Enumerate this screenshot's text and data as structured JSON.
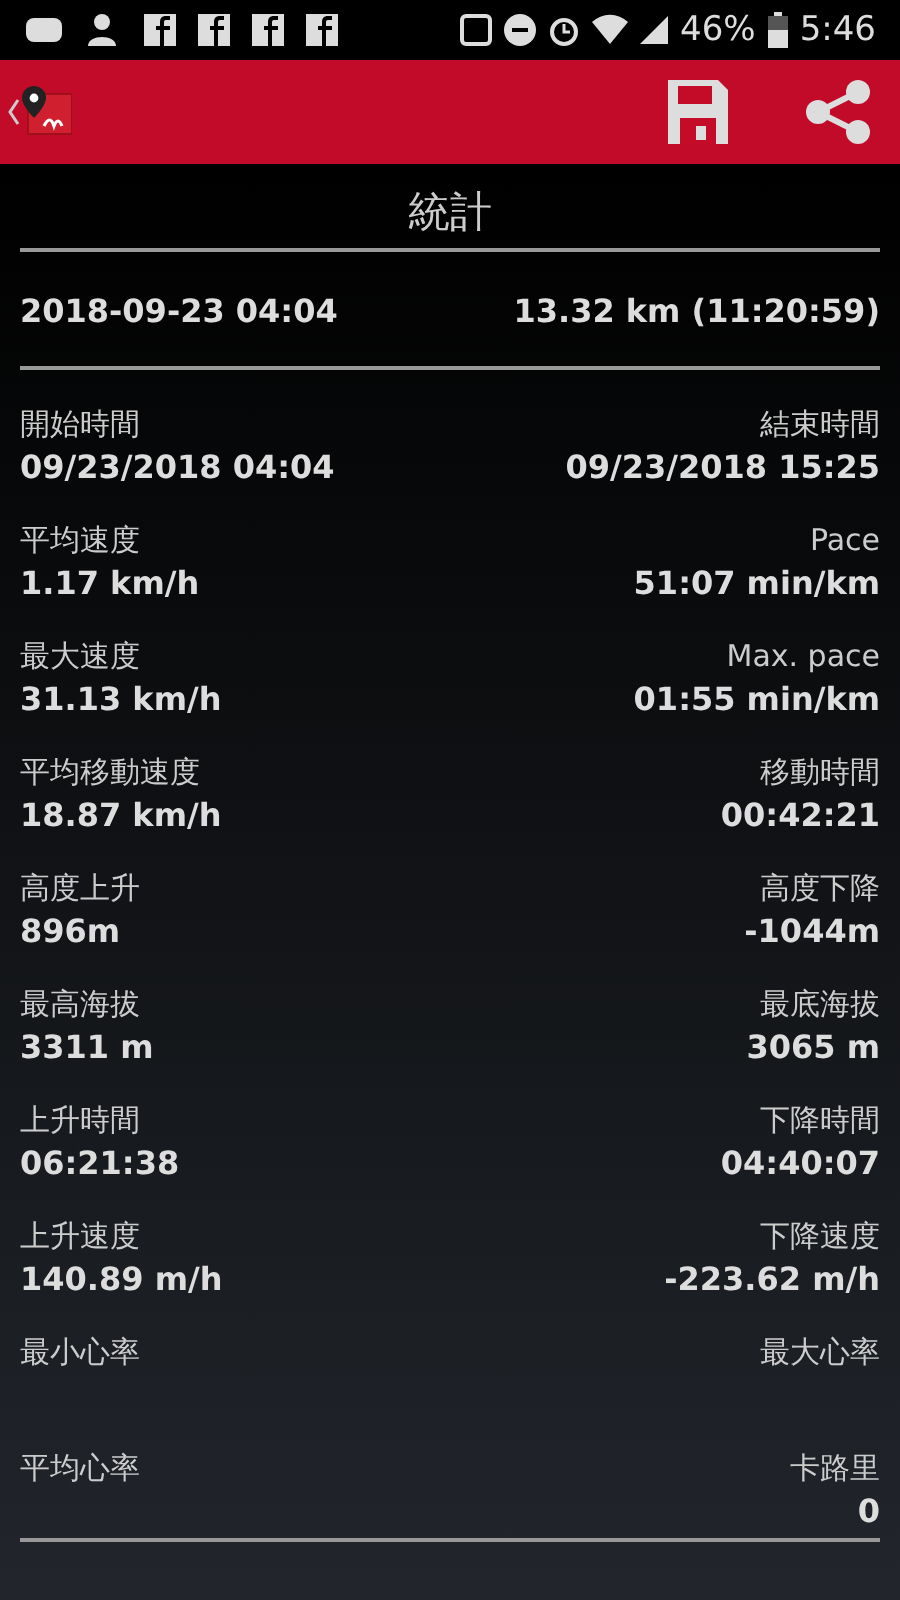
{
  "status_bar": {
    "battery": "46%",
    "time": "5:46"
  },
  "title": "統計",
  "summary": {
    "date": "2018-09-23 04:04",
    "distance": "13.32 km (11:20:59)"
  },
  "stats": [
    {
      "left_label": "開始時間",
      "left_value": "09/23/2018 04:04",
      "right_label": "結束時間",
      "right_value": "09/23/2018 15:25"
    },
    {
      "left_label": "平均速度",
      "left_value": "1.17 km/h",
      "right_label": "Pace",
      "right_value": "51:07 min/km"
    },
    {
      "left_label": "最大速度",
      "left_value": "31.13 km/h",
      "right_label": "Max. pace",
      "right_value": "01:55 min/km"
    },
    {
      "left_label": "平均移動速度",
      "left_value": "18.87 km/h",
      "right_label": "移動時間",
      "right_value": "00:42:21"
    },
    {
      "left_label": "高度上升",
      "left_value": "896m",
      "right_label": "高度下降",
      "right_value": "-1044m"
    },
    {
      "left_label": "最高海拔",
      "left_value": "3311 m",
      "right_label": "最底海拔",
      "right_value": "3065 m"
    },
    {
      "left_label": "上升時間",
      "left_value": "06:21:38",
      "right_label": "下降時間",
      "right_value": "04:40:07"
    },
    {
      "left_label": "上升速度",
      "left_value": "140.89 m/h",
      "right_label": "下降速度",
      "right_value": "-223.62 m/h"
    },
    {
      "left_label": "最小心率",
      "right_label": "最大心率"
    },
    {
      "left_label": "平均心率",
      "right_label": "卡路里",
      "right_value": "0"
    }
  ]
}
